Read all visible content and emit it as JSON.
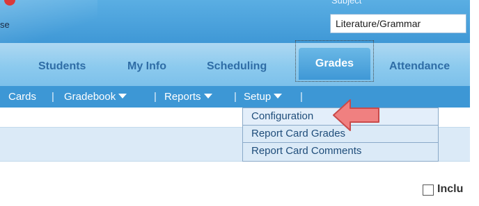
{
  "banner": {
    "partial_text": "se",
    "subject_label": "Subject",
    "subject_value": "Literature/Grammar"
  },
  "nav": {
    "items": [
      "Students",
      "My Info",
      "Scheduling",
      "Grades",
      "Attendance"
    ],
    "active": "Grades"
  },
  "subnav": {
    "cards": "Cards",
    "gradebook": "Gradebook",
    "reports": "Reports",
    "setup": "Setup",
    "separator": "|"
  },
  "setup_menu": {
    "items": [
      "Configuration",
      "Report Card Grades",
      "Report Card Comments"
    ],
    "highlighted": "Configuration"
  },
  "options": {
    "include_label": "Inclu"
  },
  "colors": {
    "banner": "#3f98d6",
    "nav_text": "#2f6da6",
    "arrow": "#f08080"
  }
}
